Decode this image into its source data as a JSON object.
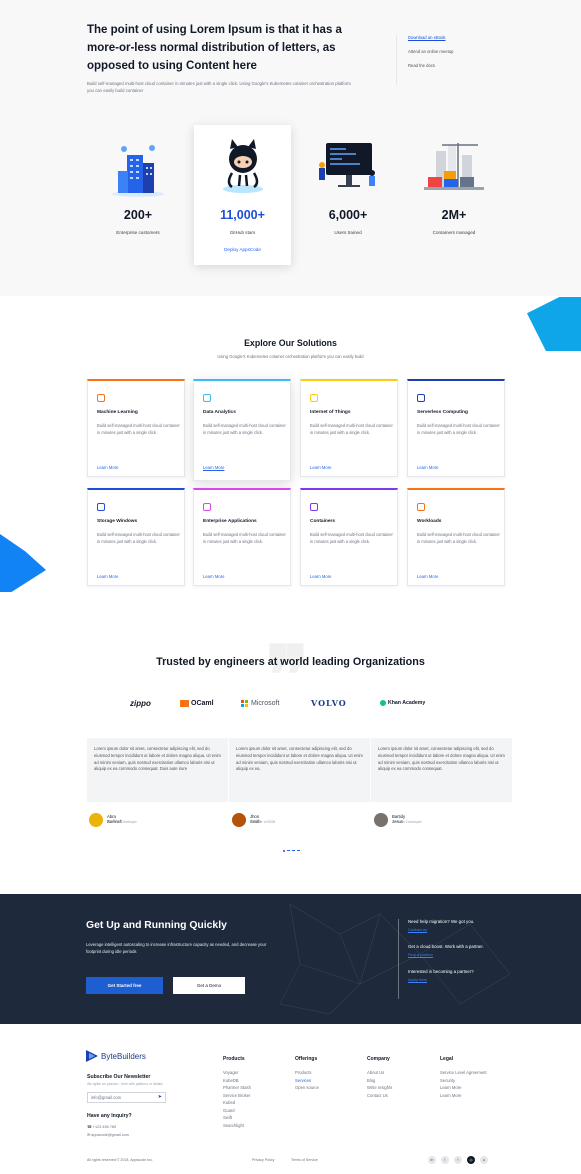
{
  "hero": {
    "title": "The point of using Lorem Ipsum is that it has a more-or-less normal distribution of letters, as opposed to using Content here",
    "subtitle": "Build self-managed multi-host cloud container in minutes just with a single click. Using Google's Kubernetes cotainer orchestration platform you can easily build container",
    "links": [
      "Download an eBook",
      "Attend an online meetup",
      "Read the docs"
    ]
  },
  "stats": [
    {
      "value": "200+",
      "label": "Enterprise customers",
      "icon": "city-buildings-icon"
    },
    {
      "value": "11,000+",
      "label": "GitHub stars",
      "link": "Deploy AppsCode",
      "icon": "github-octocat-icon"
    },
    {
      "value": "6,000+",
      "label": "Users trained",
      "icon": "training-monitor-icon"
    },
    {
      "value": "2M+",
      "label": "Containers managed",
      "icon": "containers-crane-icon"
    }
  ],
  "solutions": {
    "title": "Explore Our Solutions",
    "subtitle": "Using Google's Kubernetes cotainer orchestration platform you can easily build",
    "cards": [
      {
        "title": "Machine Learning",
        "desc": "Build self-managed multi-host cloud container in minutes just with a single click.",
        "link": "Learn More",
        "accent": "#f97316",
        "icon": "machine-learning-icon"
      },
      {
        "title": "Data Analytics",
        "desc": "Build self-managed multi-host cloud container in minutes just with a single click.",
        "link": "Learn More",
        "accent": "#38bdf8",
        "icon": "analytics-icon"
      },
      {
        "title": "Internet of Things",
        "desc": "Build self-managed multi-host cloud container in minutes just with a single click.",
        "link": "Learn More",
        "accent": "#facc15",
        "icon": "iot-icon"
      },
      {
        "title": "Serverless Computing",
        "desc": "Build self-managed multi-host cloud container in minutes just with a single click.",
        "link": "Learn More",
        "accent": "#1e40af",
        "icon": "serverless-icon"
      },
      {
        "title": "Storage Windows",
        "desc": "Build self-managed multi-host cloud container in minutes just with a single click.",
        "link": "Learn More",
        "accent": "#1d4ed8",
        "icon": "storage-icon"
      },
      {
        "title": "Enterprise Applications",
        "desc": "Build self-managed multi-host cloud container in minutes just with a single click.",
        "link": "Learn More",
        "accent": "#d946ef",
        "icon": "enterprise-icon"
      },
      {
        "title": "Containers",
        "desc": "Build self-managed multi-host cloud container in minutes just with a single click.",
        "link": "Learn More",
        "accent": "#7c3aed",
        "icon": "rocket-icon"
      },
      {
        "title": "Workloads",
        "desc": "Build self-managed multi-host cloud container in minutes just with a single click.",
        "link": "Learn More",
        "accent": "#f97316",
        "icon": "workloads-icon"
      }
    ]
  },
  "trusted": {
    "title": "Trusted by engineers at world leading Organizations",
    "logos": [
      "zippo",
      "OCaml",
      "Microsoft",
      "VOLVO",
      "Khan Academy"
    ]
  },
  "testimonials": [
    {
      "text": "Lorem ipsum dolor sit amet, consectetur adipiscing elit, sed do eiusmod tempor incididunt ut labore et dolore magna aliqua. Ut enim ad minim veniam, quis nostrud exercitation ullamco laboris nisi ut aliquip ex ea commodo consequat. Duis aute irure",
      "name": "Abra Barlinch",
      "role": "Software Developer"
    },
    {
      "text": "Lorem ipsum dolor sit amet, consectetur adipiscing elit, sed do eiusmod tempor incididunt ut labore et dolore magna aliqua. Ut enim ad minim veniam, quis nostrud exercitation ullamco laboris nisi ut aliquip ex ea.",
      "name": "Jhon Smith",
      "role": "Founder of BDIB"
    },
    {
      "text": "Lorem ipsum dolor sit amet, consectetur adipiscing elit, sed do eiusmod tempor incididunt ut labore et dolore magna aliqua. Ut enim ad minim veniam, quis nostrud exercitation ullamco laboris nisi ut aliquip ex ea commodo consequat.",
      "name": "Bartidy Jesun",
      "role": "Software Developer"
    }
  ],
  "cta": {
    "title": "Get Up and Running  Quickly",
    "desc": "Leverage intelligent autoscaling to increase infrastructure capacity as needed, and decrease your footprint during idle periods",
    "primary_button": "Get Started free",
    "secondary_button": "Get a Demo",
    "right": [
      {
        "question": "Need help migration? We got you.",
        "link": "Contact us"
      },
      {
        "question": "Get a cloud boost. Work with a partner.",
        "link": "Find a partner"
      },
      {
        "question": "Interested in becoming a partner?",
        "link": "Apply here"
      }
    ]
  },
  "footer": {
    "brand": "ByteBuilders",
    "newsletter_title": "Subscribe Our Newsletter",
    "newsletter_note": "We ignite an passion - time with patterns or details",
    "email_placeholder": "info@gmail.com",
    "inquiry_title": "Have any Inquiry?",
    "phone": "+123 456 789",
    "email": "appscode@gmail.com",
    "columns": [
      {
        "title": "Products",
        "items": [
          "Voyager",
          "KubeDB",
          "Pharmer Stash",
          "Service Broker",
          "Kubed",
          "Guard",
          "Swift",
          "Searchlight"
        ]
      },
      {
        "title": "Offerings",
        "items": [
          "Products",
          "Services",
          "Open source"
        ]
      },
      {
        "title": "Company",
        "items": [
          "About Us",
          "Blog",
          "Write Insights",
          "Contact Us"
        ]
      },
      {
        "title": "Legal",
        "items": [
          "Service Level Agreement",
          "Security",
          "Learn More",
          "Learn More"
        ]
      }
    ],
    "copyright": "All rights reserved © 2018, Appscode Inc.",
    "privacy": "Privacy Policy",
    "terms": "Terms of Service",
    "social": [
      "linkedin-icon",
      "twitter-icon",
      "facebook-icon",
      "github-icon",
      "reddit-icon"
    ]
  }
}
